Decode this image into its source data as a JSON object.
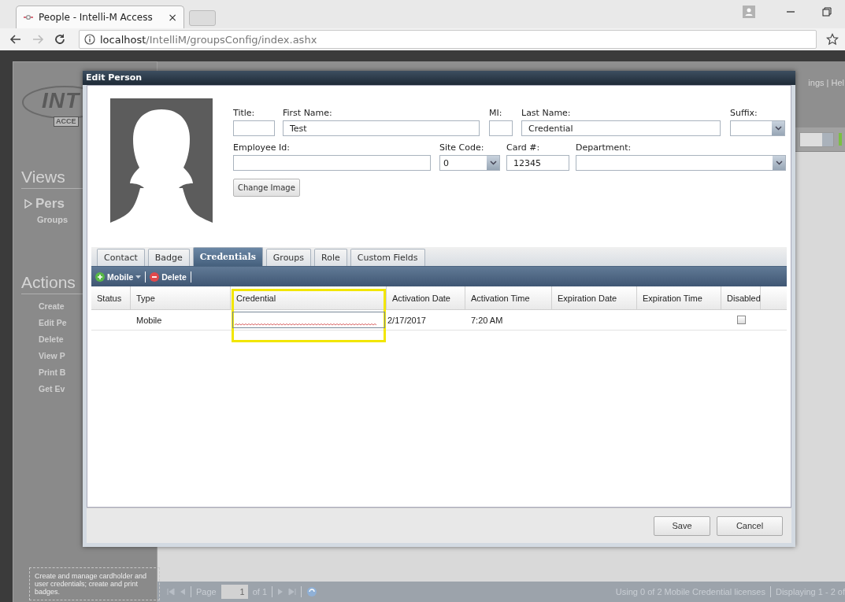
{
  "browser": {
    "tab_title": "People - Intelli-M Access",
    "tab_close": "×",
    "url_host": "localhost",
    "url_path": "/IntelliM/groupsConfig/index.ashx"
  },
  "app": {
    "logo": {
      "wordmark": "INT",
      "badge": "ACCE"
    },
    "top_links": "ings | Hel",
    "views": {
      "heading": "Views",
      "items": [
        {
          "label": "Pers",
          "selected": true
        },
        {
          "label": "Groups",
          "selected": false
        }
      ]
    },
    "actions": {
      "heading": "Actions",
      "items": [
        "Create",
        "Edit Pe",
        "Delete",
        "View P",
        "Print B",
        "Get Ev"
      ]
    },
    "help_text": "Create and manage cardholder and user credentials; create and print badges.",
    "pager": {
      "page_label": "Page",
      "page": "1",
      "of": "of 1"
    },
    "status": [
      "Using 0 of 2 Mobile Credential licenses",
      "Displaying 1 - 2 of"
    ]
  },
  "dialog": {
    "title": "Edit Person",
    "fields": [
      {
        "label": "Title:",
        "kind": "text"
      },
      {
        "label": "First Name:",
        "value": "Test",
        "kind": "text"
      },
      {
        "label": "MI:",
        "kind": "text"
      },
      {
        "label": "Last Name:",
        "value": "Credential",
        "kind": "text"
      },
      {
        "label": "Suffix:",
        "kind": "select"
      },
      {
        "label": "Employee Id:",
        "kind": "text"
      },
      {
        "label": "Site Code:",
        "value": "0",
        "kind": "select"
      },
      {
        "label": "Card #:",
        "value": "12345",
        "kind": "text"
      },
      {
        "label": "Department:",
        "kind": "select"
      }
    ],
    "change_image_button": "Change Image",
    "tabs": [
      {
        "label": "Contact",
        "selected": false
      },
      {
        "label": "Badge",
        "selected": false
      },
      {
        "label": "Credentials",
        "selected": true
      },
      {
        "label": "Groups",
        "selected": false
      },
      {
        "label": "Role",
        "selected": false
      },
      {
        "label": "Custom Fields",
        "selected": false
      }
    ],
    "toolbar": [
      {
        "label": "Mobile",
        "kind": "add",
        "menu": true
      },
      {
        "label": "Delete",
        "kind": "delete",
        "menu": false
      }
    ],
    "grid": {
      "columns": [
        "Status",
        "Type",
        "Credential",
        "Activation Date",
        "Activation Time",
        "Expiration Date",
        "Expiration Time",
        "Disabled"
      ],
      "rows": [
        {
          "type": "Mobile",
          "credential": {
            "editing": true,
            "highlighted": true
          },
          "activation_date": "2/17/2017",
          "activation_time": "7:20 AM",
          "disabled": false
        }
      ]
    },
    "buttons": [
      "Save",
      "Cancel"
    ]
  }
}
